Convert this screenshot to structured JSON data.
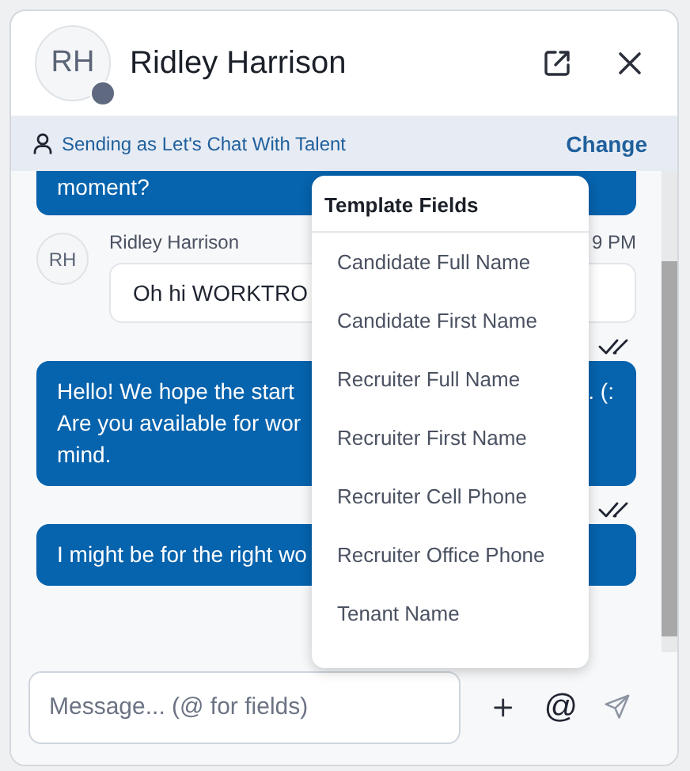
{
  "header": {
    "initials": "RH",
    "name": "Ridley Harrison"
  },
  "sender_bar": {
    "text": "Sending as Let's Chat With Talent",
    "action": "Change"
  },
  "messages": [
    {
      "kind": "outgoing",
      "cut_top": true,
      "lines": [
        {
          "left": "moment?"
        }
      ]
    },
    {
      "kind": "incoming",
      "initials": "RH",
      "author": "Ridley Harrison",
      "time": "9 PM",
      "lines": [
        {
          "left": "Oh hi WORKTRO"
        }
      ]
    },
    {
      "kind": "receipt"
    },
    {
      "kind": "outgoing",
      "cut_top": false,
      "lines": [
        {
          "left": "Hello! We hope the start",
          "right": ". (:"
        },
        {
          "left": "Are you available for wor"
        },
        {
          "left": "mind."
        }
      ]
    },
    {
      "kind": "receipt"
    },
    {
      "kind": "outgoing",
      "cut_top": false,
      "lines": [
        {
          "left": "I might be for the right wo"
        }
      ]
    }
  ],
  "template_menu": {
    "title": "Template Fields",
    "items": [
      "Candidate Full Name",
      "Candidate First Name",
      "Recruiter Full Name",
      "Recruiter First Name",
      "Recruiter Cell Phone",
      "Recruiter Office Phone",
      "Tenant Name"
    ]
  },
  "composer": {
    "placeholder": "Message... (@ for fields)",
    "mention": "@"
  }
}
